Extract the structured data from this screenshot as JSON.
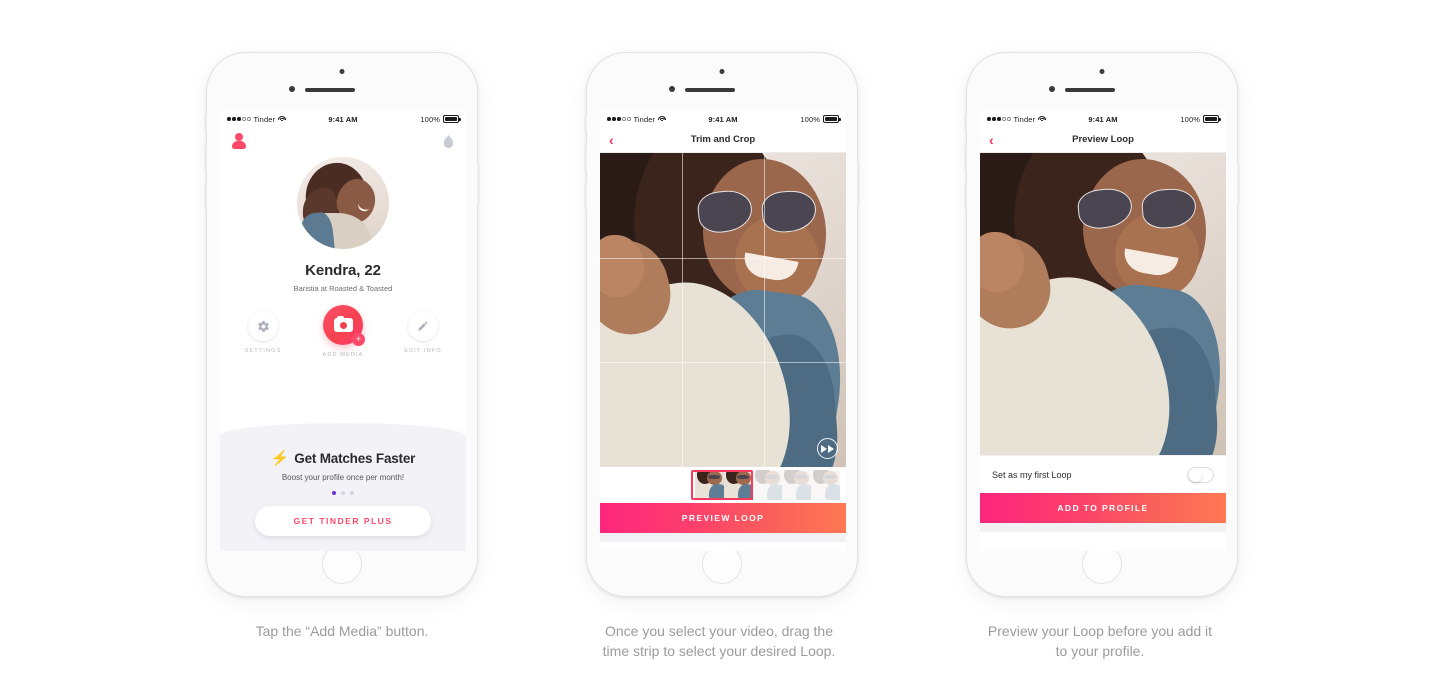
{
  "page": {
    "background": "#ffffff",
    "accent_pink": "#fd4a6a",
    "gradient_start": "#fd267d",
    "gradient_end": "#ff7854"
  },
  "status_bar": {
    "carrier": "Tinder",
    "time": "9:41 AM",
    "battery": "100%"
  },
  "screen1": {
    "icons": {
      "profile": "person-icon",
      "flame": "flame-icon"
    },
    "name": "Kendra, 22",
    "job": "Baristia at Roasted & Toasted",
    "actions": [
      {
        "icon": "gear-icon",
        "label": "SETTINGS"
      },
      {
        "icon": "camera-plus-icon",
        "label": "ADD MEDIA"
      },
      {
        "icon": "pencil-icon",
        "label": "EDIT INFO"
      }
    ],
    "promo": {
      "bolt": "⚡",
      "title": "Get Matches Faster",
      "subtitle": "Boost your profile once per month!",
      "dots": 3,
      "active_dot": 0,
      "cta": "GET TINDER PLUS"
    }
  },
  "screen2": {
    "nav": {
      "back": "‹",
      "title": "Trim and Crop"
    },
    "play_button": "fast-forward-icon",
    "filmstrip": {
      "total_frames": 6,
      "selected_start": 0,
      "selected_count": 2
    },
    "cta": "PREVIEW LOOP"
  },
  "screen3": {
    "nav": {
      "back": "‹",
      "title": "Preview Loop"
    },
    "toggle": {
      "label": "Set as my first Loop",
      "checked": false
    },
    "cta": "ADD TO PROFILE"
  },
  "captions": {
    "one": "Tap the “Add Media” button.",
    "two_line1": "Once you select your video, drag the",
    "two_line2": "time strip to select your desired Loop.",
    "three_line1": "Preview your Loop before you add it",
    "three_line2": "to your profile."
  }
}
